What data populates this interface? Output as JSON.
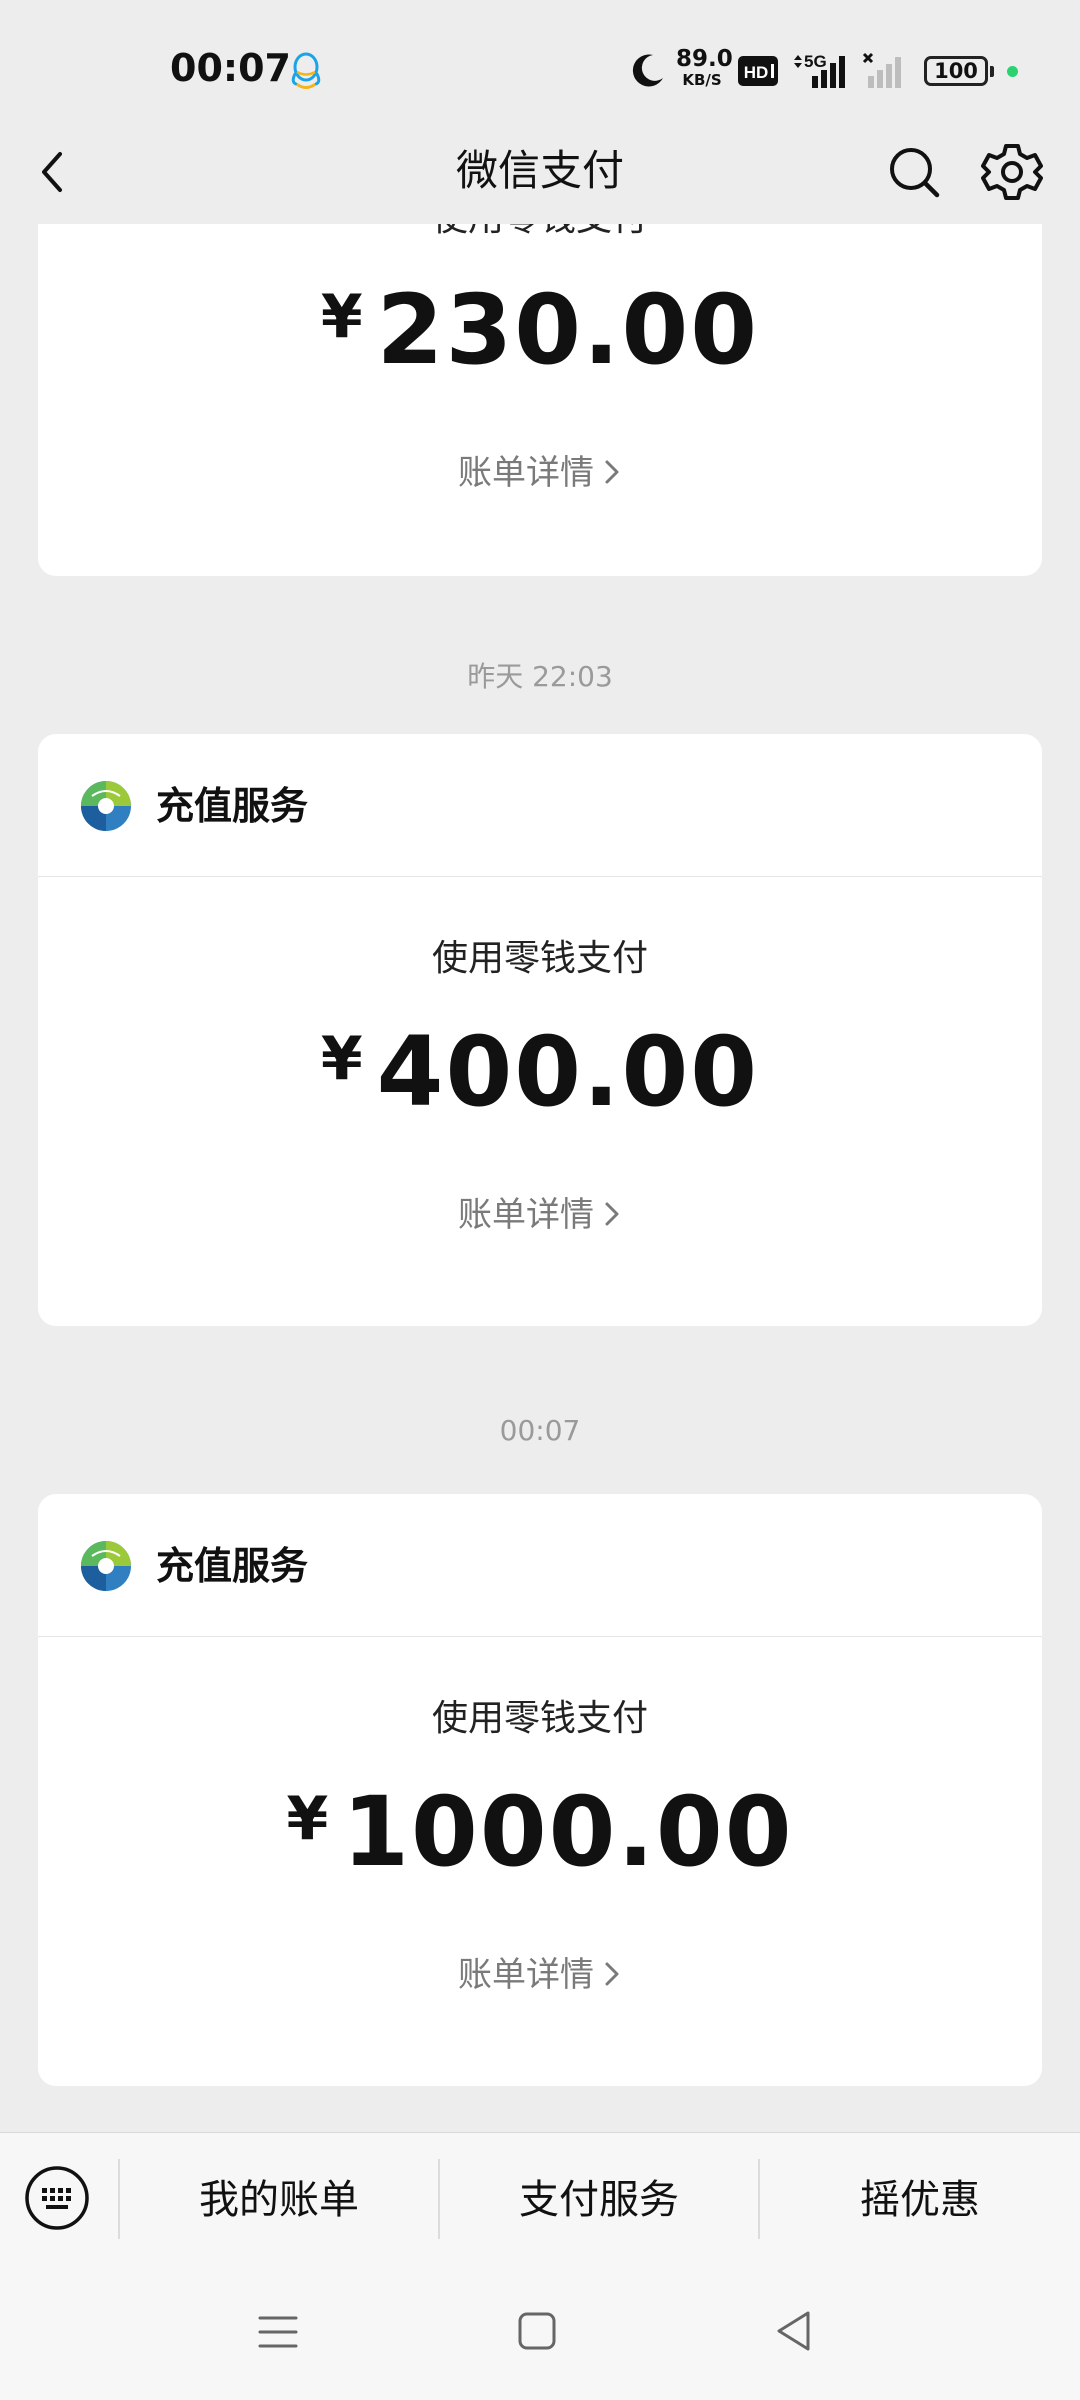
{
  "status_bar": {
    "time": "00:07",
    "net_speed_value": "89.0",
    "net_speed_unit": "KB/S",
    "hd_label": "HD",
    "signal_label": "5G",
    "battery": "100",
    "icons": [
      "qq-icon",
      "moon-icon",
      "hd-icon",
      "signal-5g-icon",
      "signal-no-sim-icon",
      "battery-icon"
    ]
  },
  "nav": {
    "title": "微信支付",
    "icons": [
      "back-icon",
      "search-icon",
      "gear-icon"
    ]
  },
  "messages": [
    {
      "timestamp": "",
      "merchant": "",
      "pay_method": "使用零钱支付",
      "currency": "¥",
      "amount": "230.00",
      "detail_label": "账单详情"
    },
    {
      "timestamp": "昨天 22:03",
      "merchant": "充值服务",
      "pay_method": "使用零钱支付",
      "currency": "¥",
      "amount": "400.00",
      "detail_label": "账单详情"
    },
    {
      "timestamp": "00:07",
      "merchant": "充值服务",
      "pay_method": "使用零钱支付",
      "currency": "¥",
      "amount": "1000.00",
      "detail_label": "账单详情"
    }
  ],
  "bottom_menu": {
    "items": [
      "我的账单",
      "支付服务",
      "摇优惠"
    ]
  },
  "colors": {
    "background": "#ededed",
    "card": "#ffffff",
    "status_dot": "#2ed16f",
    "secondary_text": "#7a7a7a"
  }
}
